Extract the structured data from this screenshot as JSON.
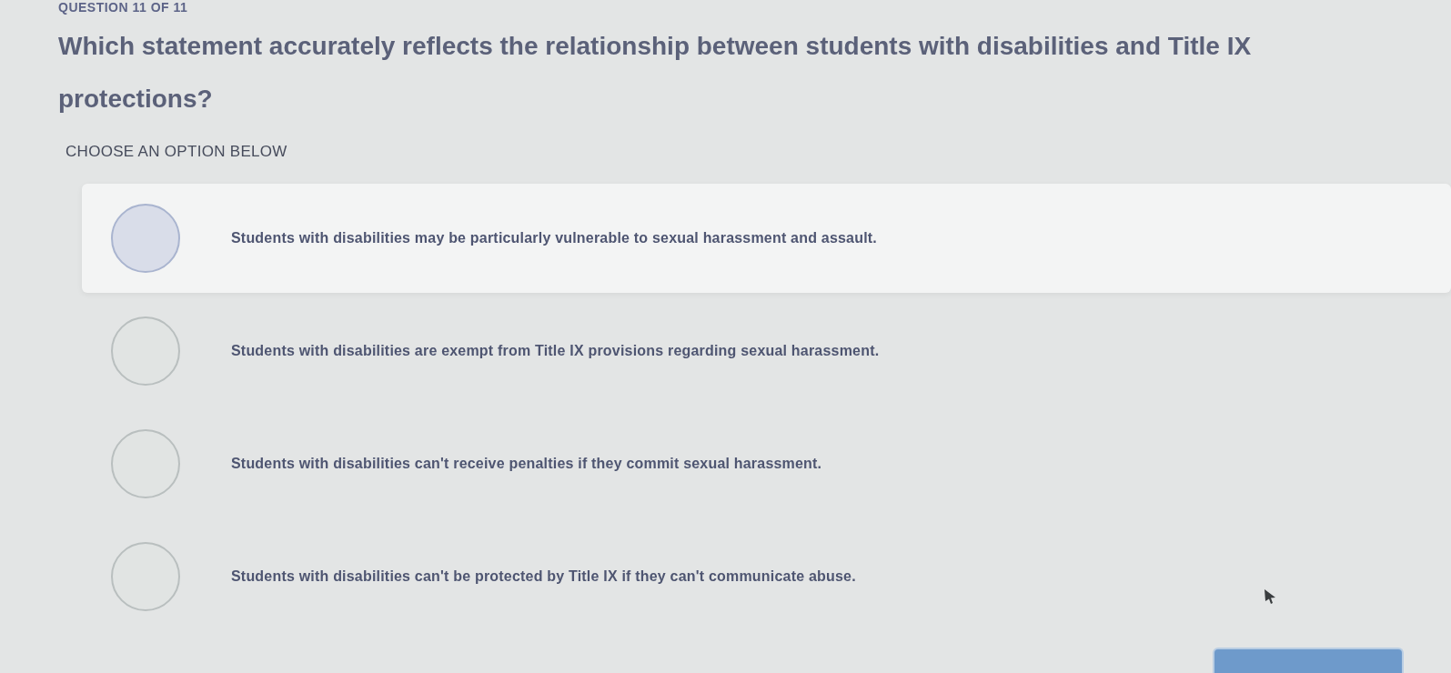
{
  "header": {
    "counter": "QUESTION 11 OF 11"
  },
  "question": {
    "text": "Which statement accurately reflects the relationship between students with disabilities and Title IX protections?"
  },
  "instruction": "CHOOSE AN OPTION BELOW",
  "options": [
    {
      "text": "Students with disabilities may be particularly vulnerable to sexual harassment and assault.",
      "highlighted": true
    },
    {
      "text": "Students with disabilities are exempt from Title IX provisions regarding sexual harassment.",
      "highlighted": false
    },
    {
      "text": "Students with disabilities can't receive penalties if they commit sexual harassment.",
      "highlighted": false
    },
    {
      "text": "Students with disabilities can't be protected by Title IX if they can't communicate abuse.",
      "highlighted": false
    }
  ]
}
